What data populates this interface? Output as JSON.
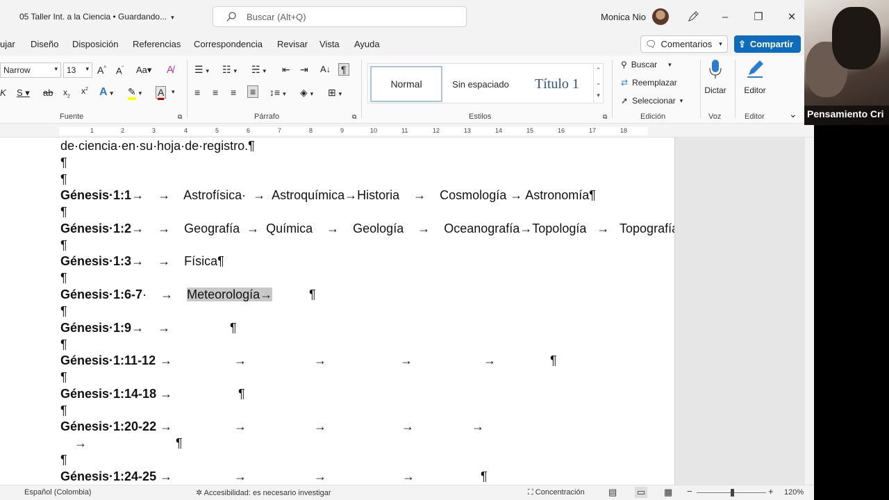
{
  "title_bar": {
    "doc_title": "05 Taller Int. a la Ciencia • Guardando...",
    "search_placeholder": "Buscar (Alt+Q)",
    "user_name": "Monica Nio",
    "minimize": "–",
    "maximize": "❐",
    "close": "✕"
  },
  "menu": {
    "tabs": [
      "ujar",
      "Diseño",
      "Disposición",
      "Referencias",
      "Correspondencia",
      "Revisar",
      "Vista",
      "Ayuda"
    ],
    "comments_label": "Comentarios",
    "share_label": "Compartir"
  },
  "ribbon": {
    "font_name": "Narrow",
    "font_size": "13",
    "groups": {
      "fuente": "Fuente",
      "parrafo": "Párrafo",
      "estilos": "Estilos",
      "edicion": "Edición",
      "voz": "Voz",
      "editor": "Editor"
    },
    "styles": [
      "Normal",
      "Sin espaciado",
      "Título 1"
    ],
    "editing": {
      "find": "Buscar",
      "replace": "Reemplazar",
      "select": "Seleccionar"
    },
    "dictate": "Dictar",
    "editor": "Editor"
  },
  "ruler": {
    "numbers": [
      "1",
      "1",
      "2",
      "3",
      "4",
      "5",
      "6",
      "7",
      "8",
      "9",
      "10",
      "11",
      "12",
      "13",
      "14",
      "15",
      "16",
      "17",
      "18"
    ]
  },
  "document": {
    "intro": "de·ciencia·en·su·hoja·de·registro.¶",
    "pilcrow": "¶",
    "arrow": "→",
    "rows": [
      {
        "ref": "Génesis·1:1",
        "text": "→    →    Astrofísica·  →  Astroquímica→Historia    →    Cosmología → Astronomía¶"
      },
      {
        "ref": "Génesis·1:2",
        "text": "→    →    Geografía  →  Química    →    Geología    →    Oceanografía→Topología   →   Topografía¶"
      },
      {
        "ref": "Génesis·1:3",
        "text": "→    →    Física¶"
      },
      {
        "ref": "Génesis·1:6-7",
        "pre": "·    →    ",
        "highlight": "Meteorología→",
        "end": "¶"
      },
      {
        "ref": "Génesis·1:9",
        "text": "→    →",
        "end": "¶"
      },
      {
        "ref": "Génesis·1:11-12",
        "text": "→",
        "end": "¶"
      },
      {
        "ref": "Génesis·1:14-18",
        "text": "→",
        "end": "¶"
      },
      {
        "ref": "Génesis·1:20-22",
        "text": "→",
        "end": "¶"
      },
      {
        "ref": "Génesis·1:24-25",
        "text": "→",
        "end": "¶"
      }
    ]
  },
  "status_bar": {
    "language": "Español (Colombia)",
    "accessibility": "Accesibilidad: es necesario investigar",
    "focus": "Concentración",
    "zoom": "120%"
  },
  "video": {
    "label": "Pensamiento Cri"
  }
}
